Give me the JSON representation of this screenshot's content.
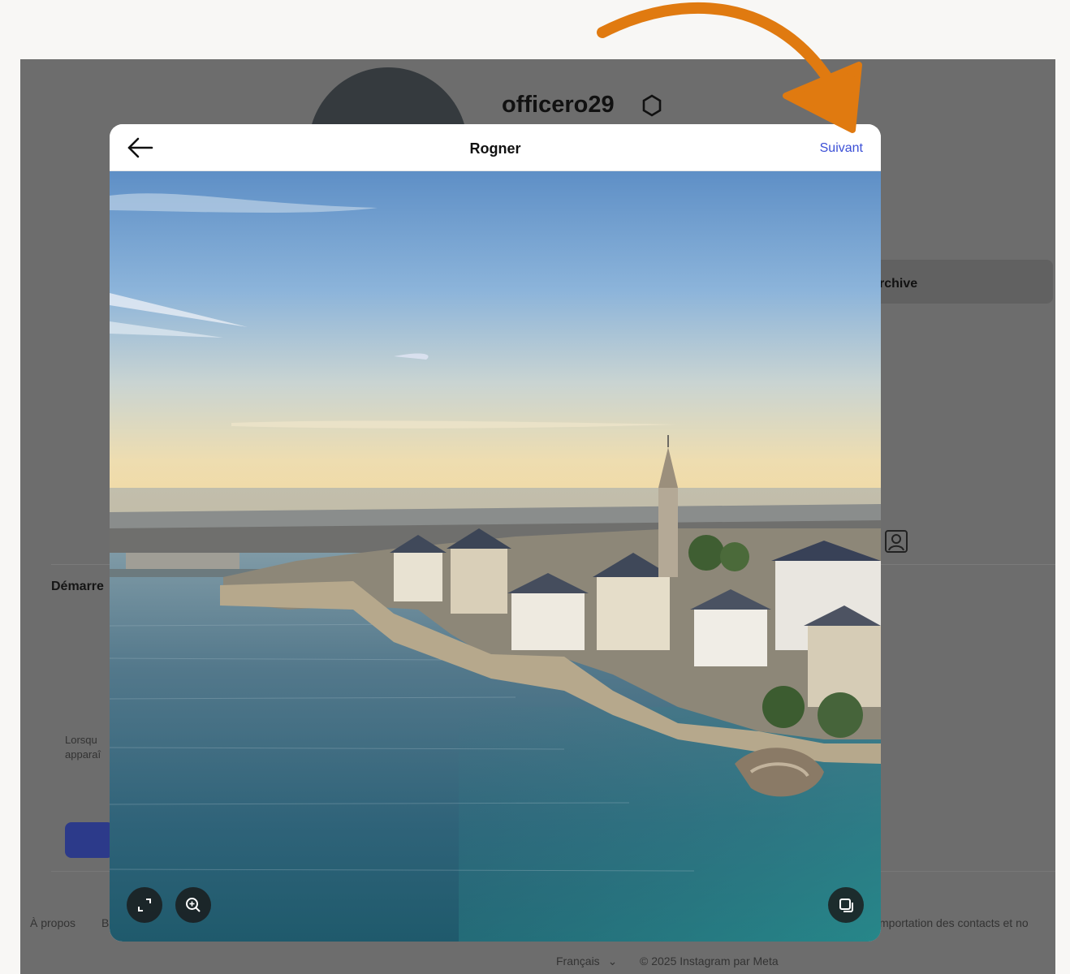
{
  "profile": {
    "username": "officero29"
  },
  "background": {
    "archive_label": "rchive",
    "demarrer_label": "Démarre",
    "info_line1": "Lorsqu",
    "info_line2": "apparaî"
  },
  "footer": {
    "about": "À propos",
    "b_link": "B",
    "contacts": "mportation des contacts et no",
    "language": "Français",
    "copyright": "© 2025 Instagram par Meta"
  },
  "modal": {
    "title": "Rogner",
    "next_label": "Suivant"
  },
  "icons": {
    "back": "arrow-left-icon",
    "settings": "gear-icon",
    "tagged": "person-tag-icon",
    "aspect": "expand-arrows-icon",
    "zoom": "zoom-in-icon",
    "gallery": "multi-select-icon",
    "annotation": "curved-arrow-icon"
  },
  "colors": {
    "accent": "#3b4fd6",
    "annotation_arrow": "#e07a10",
    "overlay": "#6d6d6d"
  }
}
